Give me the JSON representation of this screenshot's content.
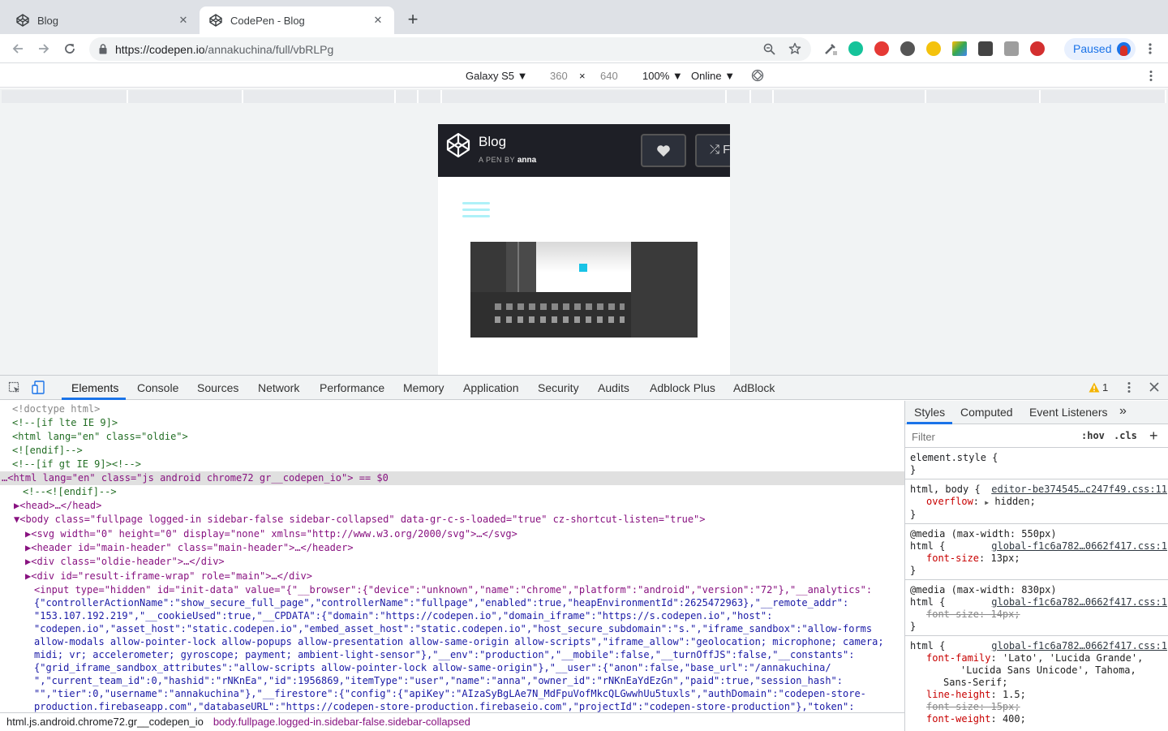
{
  "browser": {
    "tabs": [
      {
        "title": "Blog",
        "close": "✕"
      },
      {
        "title": "CodePen - Blog",
        "close": "✕"
      }
    ],
    "new_tab": "+",
    "url": {
      "host": "https://codepen.io",
      "path": "/annakuchina/full/vbRLPg"
    },
    "profile_label": "Paused"
  },
  "device_toolbar": {
    "device": "Galaxy S5 ▼",
    "width": "360",
    "times": "×",
    "height": "640",
    "zoom": "100% ▼",
    "throttle": "Online ▼"
  },
  "pen": {
    "title": "Blog",
    "by_prefix": "A PEN BY",
    "author": "anna",
    "fork_glyph": "⤮ F"
  },
  "devtools": {
    "tabs": [
      "Elements",
      "Console",
      "Sources",
      "Network",
      "Performance",
      "Memory",
      "Application",
      "Security",
      "Audits",
      "Adblock Plus",
      "AdBlock"
    ],
    "warnings": "1",
    "dom_lines": [
      "<!doctype html>",
      "<!--[if lte IE 9]>",
      "<html lang=\"en\" class=\"oldie\">",
      "<![endif]-->",
      "<!--[if gt IE 9]><!-->",
      "…<html lang=\"en\" class=\"js android chrome72 gr__codepen_io\"> == $0",
      "<!--<![endif]-->",
      "▶<head>…</head>",
      "▼<body class=\"fullpage logged-in sidebar-false sidebar-collapsed\" data-gr-c-s-loaded=\"true\" cz-shortcut-listen=\"true\">",
      "▶<svg width=\"0\" height=\"0\" display=\"none\" xmlns=\"http://www.w3.org/2000/svg\">…</svg>",
      "▶<header id=\"main-header\" class=\"main-header\">…</header>",
      "▶<div class=\"oldie-header\">…</div>",
      "▶<div id=\"result-iframe-wrap\" role=\"main\">…</div>",
      "<input type=\"hidden\" id=\"init-data\" value=\"{\"__browser\":{\"device\":\"unknown\",\"name\":\"chrome\",\"platform\":\"android\",\"version\":\"72\"},\"__analytics\":",
      "{\"controllerActionName\":\"show_secure_full_page\",\"controllerName\":\"fullpage\",\"enabled\":true,\"heapEnvironmentId\":2625472963},\"__remote_addr\":",
      "\"153.107.192.219\",\"__cookieUsed\":true,\"__CPDATA\":{\"domain\":\"https://codepen.io\",\"domain_iframe\":\"https://s.codepen.io\",\"host\":",
      "\"codepen.io\",\"asset_host\":\"static.codepen.io\",\"embed_asset_host\":\"static.codepen.io\",\"host_secure_subdomain\":\"s.\",\"iframe_sandbox\":\"allow-forms",
      "allow-modals allow-pointer-lock allow-popups allow-presentation allow-same-origin allow-scripts\",\"iframe_allow\":\"geolocation; microphone; camera;",
      "midi; vr; accelerometer; gyroscope; payment; ambient-light-sensor\"},\"__env\":\"production\",\"__mobile\":false,\"__turnOffJS\":false,\"__constants\":",
      "{\"grid_iframe_sandbox_attributes\":\"allow-scripts allow-pointer-lock allow-same-origin\"},\"__user\":{\"anon\":false,\"base_url\":\"/annakuchina/",
      "\",\"current_team_id\":0,\"hashid\":\"rNKnEa\",\"id\":1956869,\"itemType\":\"user\",\"name\":\"anna\",\"owner_id\":\"rNKnEaYdEzGn\",\"paid\":true,\"session_hash\":",
      "\"\",\"tier\":0,\"username\":\"annakuchina\"},\"__firestore\":{\"config\":{\"apiKey\":\"AIzaSyBgLAe7N_MdFpuVofMkcQLGwwhUu5tuxls\",\"authDomain\":\"codepen-store-",
      "production.firebaseapp.com\",\"databaseURL\":\"https://codepen-store-production.firebaseio.com\",\"projectId\":\"codepen-store-production\"},\"token\":"
    ],
    "breadcrumbs": [
      "html.js.android.chrome72.gr__codepen_io",
      "body.fullpage.logged-in.sidebar-false.sidebar-collapsed"
    ],
    "side_tabs": [
      "Styles",
      "Computed",
      "Event Listeners",
      "»"
    ],
    "filter_placeholder": "Filter",
    "hov": ":hov",
    "cls": ".cls",
    "plus": "+",
    "rules": {
      "r1_sel": "element.style {",
      "close": "}",
      "r2_sel": "html, body {",
      "r2_src": "editor-be374545…c247f49.css:11",
      "r2_prop": "overflow",
      "r2_val": "hidden;",
      "r3_media": "@media (max-width: 550px)",
      "r3_sel": "html {",
      "r3_src": "global-f1c6a782…0662f417.css:1",
      "r3_prop": "font-size",
      "r3_val": "13px;",
      "r4_media": "@media (max-width: 830px)",
      "r4_sel": "html {",
      "r4_src": "global-f1c6a782…0662f417.css:1",
      "r4_prop": "font-size: 14px;",
      "r5_sel": "html {",
      "r5_src": "global-f1c6a782…0662f417.css:1",
      "r5_prop1": "font-family",
      "r5_val1a": "'Lato', 'Lucida Grande',",
      "r5_val1b": "'Lucida Sans Unicode', Tahoma,",
      "r5_val1c": "Sans-Serif;",
      "r5_prop2": "line-height",
      "r5_val2": "1.5;",
      "r5_prop3": "font-size: 15px;",
      "r5_prop4": "font-weight",
      "r5_val4": "400;"
    }
  }
}
